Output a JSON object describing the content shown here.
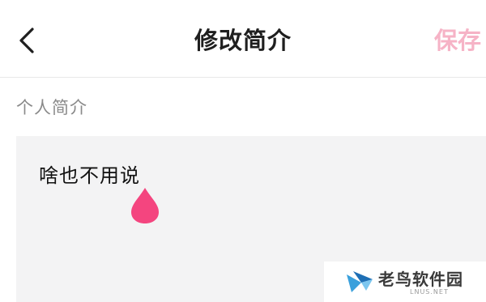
{
  "header": {
    "title": "修改简介",
    "save_label": "保存",
    "back_icon": "chevron-left-icon"
  },
  "section": {
    "label": "个人简介"
  },
  "bio": {
    "value": "啥也不用说"
  },
  "watermark": {
    "text": "老鸟软件园",
    "sub": "LNUS.NET"
  },
  "colors": {
    "accent_pink": "#f4457f",
    "save_disabled": "#f6b3c6",
    "input_bg": "#f3f3f4",
    "label_gray": "#8a8a8a"
  }
}
